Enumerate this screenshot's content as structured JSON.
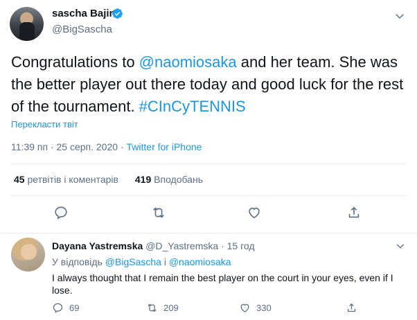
{
  "main_tweet": {
    "author_name": "sascha Bajin",
    "author_handle": "@BigSascha",
    "text_parts": {
      "p1": "Congratulations to ",
      "mention": "@naomiosaka",
      "p2": " and her team. She was the better player out there today and good luck for the rest of the tournament. ",
      "hashtag": "#CInCyTENNIS"
    },
    "translate_label": "Перекласти твіт",
    "time": "11:39 пп",
    "separator": "·",
    "date": "25 серп. 2020",
    "source": "Twitter for iPhone",
    "retweets_count": "45",
    "retweets_label": "ретвітів і коментарів",
    "likes_count": "419",
    "likes_label": "Вподобань"
  },
  "reply": {
    "author_name": "Dayana Yastremska",
    "author_handle": "@D_Yastremska",
    "separator": "·",
    "time_ago": "15 год",
    "reply_prefix": "У відповідь ",
    "reply_mention_1": "@BigSascha",
    "reply_joiner": " і ",
    "reply_mention_2": "@naomiosaka",
    "text": "I always thought that I remain the best player on the court in your eyes, even if I lose.",
    "replies_count": "69",
    "retweets_count": "209",
    "likes_count": "330"
  },
  "colors": {
    "accent": "#1b95e0",
    "muted": "#5b7083",
    "text": "#0f1419",
    "divider": "#e6ecf0"
  },
  "icons": {
    "verified": "verified-badge-icon",
    "more": "chevron-down-icon",
    "reply": "reply-bubble-icon",
    "retweet": "retweet-icon",
    "like": "heart-icon",
    "share": "share-icon"
  }
}
